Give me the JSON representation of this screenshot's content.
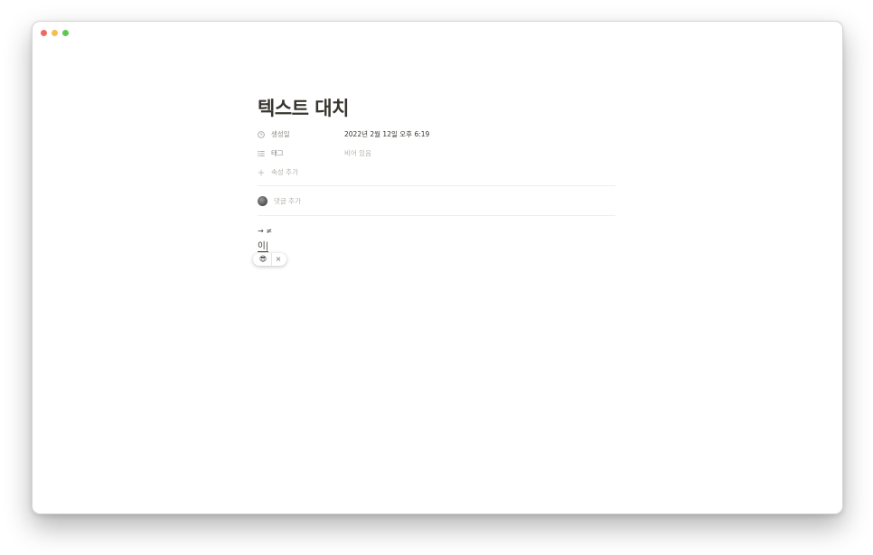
{
  "window": {
    "controls": [
      "close",
      "minimize",
      "zoom"
    ],
    "colors": {
      "close": "#ed6a5e",
      "minimize": "#f5bf4f",
      "zoom": "#61c554"
    }
  },
  "page": {
    "title": "텍스트 대치",
    "properties": [
      {
        "icon": "clock-icon",
        "name": "생성일",
        "value": "2022년 2월 12일 오후 6:19",
        "empty": false
      },
      {
        "icon": "list-icon",
        "name": "태그",
        "value": "비어 있음",
        "empty": true
      }
    ],
    "add_property_label": "속성 추가",
    "add_comment_label": "댓글 추가",
    "blocks": [
      {
        "text": "→ ≠"
      },
      {
        "text": "이|"
      }
    ],
    "suggestion": {
      "emoji": "😎",
      "close": "×"
    }
  }
}
